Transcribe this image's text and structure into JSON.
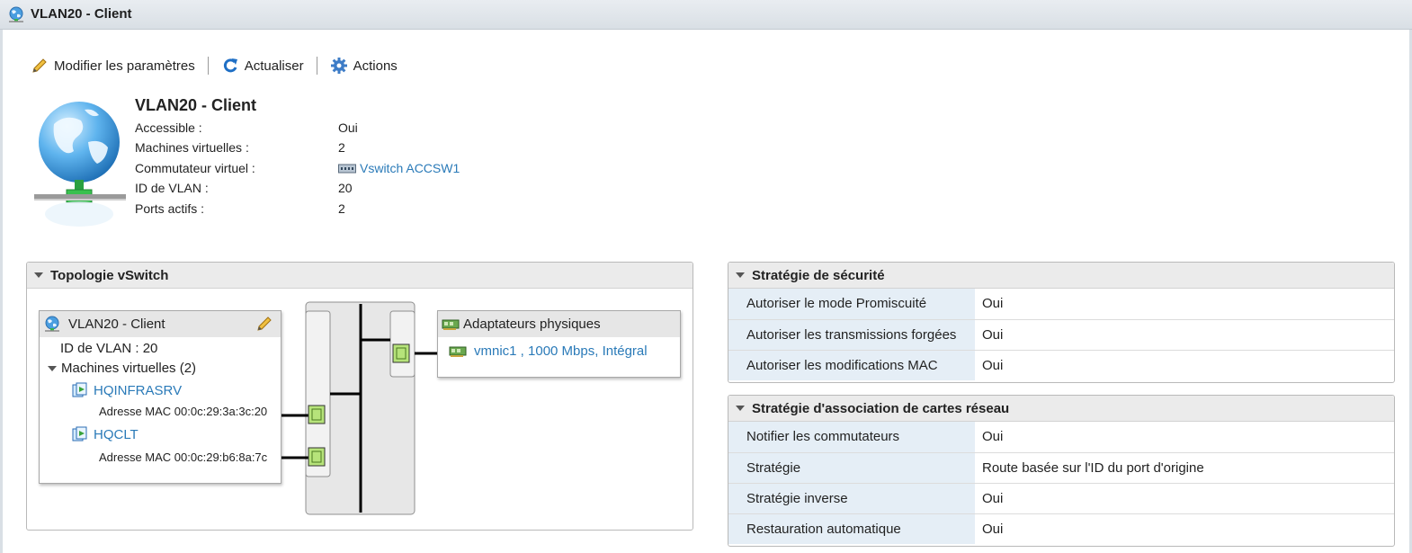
{
  "window": {
    "title": "VLAN20 - Client"
  },
  "toolbar": {
    "edit_label": "Modifier les paramètres",
    "refresh_label": "Actualiser",
    "actions_label": "Actions"
  },
  "summary": {
    "title": "VLAN20 - Client",
    "rows": [
      {
        "label": "Accessible :",
        "value": "Oui"
      },
      {
        "label": "Machines virtuelles :",
        "value": "2"
      },
      {
        "label": "Commutateur virtuel :",
        "value": "Vswitch ACCSW1"
      },
      {
        "label": "ID de VLAN :",
        "value": "20"
      },
      {
        "label": "Ports actifs :",
        "value": "2"
      }
    ]
  },
  "topology": {
    "header": "Topologie vSwitch",
    "portgroup": {
      "name": "VLAN20 - Client",
      "vlan_line": "ID de VLAN : 20",
      "vms_line": "Machines virtuelles (2)",
      "vms": [
        {
          "name": "HQINFRASRV",
          "mac": "Adresse MAC 00:0c:29:3a:3c:20"
        },
        {
          "name": "HQCLT",
          "mac": "Adresse MAC 00:0c:29:b6:8a:7c"
        }
      ]
    },
    "physical": {
      "header": "Adaptateurs physiques",
      "nic": "vmnic1 , 1000 Mbps, Intégral"
    }
  },
  "security": {
    "header": "Stratégie de sécurité",
    "rows": [
      {
        "label": "Autoriser le mode Promiscuité",
        "value": "Oui"
      },
      {
        "label": "Autoriser les transmissions forgées",
        "value": "Oui"
      },
      {
        "label": "Autoriser les modifications MAC",
        "value": "Oui"
      }
    ]
  },
  "teaming": {
    "header": "Stratégie d'association de cartes réseau",
    "rows": [
      {
        "label": "Notifier les commutateurs",
        "value": "Oui"
      },
      {
        "label": "Stratégie",
        "value": "Route basée sur l'ID du port d'origine"
      },
      {
        "label": "Stratégie inverse",
        "value": "Oui"
      },
      {
        "label": "Restauration automatique",
        "value": "Oui"
      }
    ]
  },
  "colors": {
    "link": "#2a7ab8",
    "key_bg": "#e5eef6",
    "port_green": "#b6e37a"
  }
}
